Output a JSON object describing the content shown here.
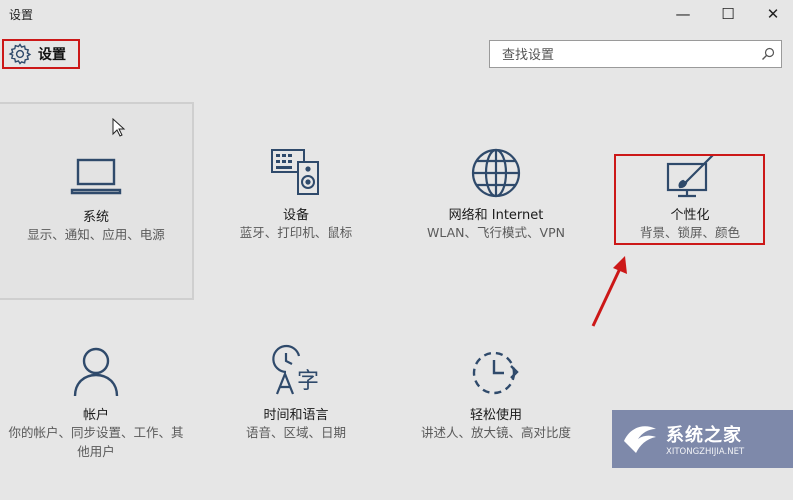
{
  "window": {
    "title": "设置",
    "minimize_glyph": "—",
    "maximize_glyph": "☐",
    "close_glyph": "✕"
  },
  "header": {
    "label": "设置",
    "icon": "gear-icon"
  },
  "search": {
    "placeholder": "查找设置",
    "icon": "search-icon"
  },
  "tiles": [
    {
      "name": "系统",
      "desc": "显示、通知、应用、电源",
      "icon": "laptop-icon"
    },
    {
      "name": "设备",
      "desc": "蓝牙、打印机、鼠标",
      "icon": "keyboard-speaker-icon"
    },
    {
      "name": "网络和 Internet",
      "desc": "WLAN、飞行模式、VPN",
      "icon": "globe-icon"
    },
    {
      "name": "个性化",
      "desc": "背景、锁屏、颜色",
      "icon": "paint-monitor-icon"
    },
    {
      "name": "帐户",
      "desc": "你的帐户、同步设置、工作、其他用户",
      "icon": "person-icon"
    },
    {
      "name": "时间和语言",
      "desc": "语音、区域、日期",
      "icon": "time-language-icon"
    },
    {
      "name": "轻松使用",
      "desc": "讲述人、放大镜、高对比度",
      "icon": "ease-of-access-icon"
    }
  ],
  "annotation": {
    "highlight_color": "#cc1818"
  },
  "watermark": {
    "cn": "系统之家",
    "en": "XITONGZHIJIA.NET"
  },
  "colors": {
    "background": "#e6e6e6",
    "icon": "#2f4a6b",
    "accent_red": "#cc1818"
  }
}
